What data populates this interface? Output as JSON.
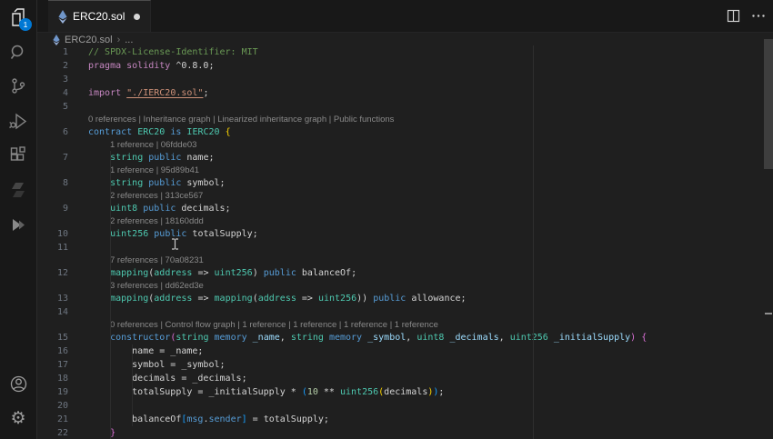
{
  "activity_bar": {
    "explorer_badge": "1",
    "items": [
      "explorer",
      "search",
      "source-control",
      "run-and-debug",
      "extensions",
      "solidity",
      "ethereum",
      "account",
      "settings"
    ]
  },
  "tab_bar": {
    "tabs": [
      {
        "label": "ERC20.sol",
        "modified": true
      }
    ]
  },
  "breadcrumb": {
    "file": "ERC20.sol",
    "chevron": "›",
    "ellipsis": "..."
  },
  "palette": {
    "background": "#1f1f1f",
    "panel": "#181818",
    "comment": "#6a9955",
    "keyword": "#c586c0",
    "type": "#4ec9b0",
    "keyword2": "#569cd6",
    "variable": "#9cdcfe",
    "string": "#ce9178",
    "number": "#b5cea8",
    "text": "#d4d4d4",
    "lens": "#8a8a8a",
    "bracket_gold": "#ffd700",
    "bracket_pink": "#da70d6",
    "bracket_blue": "#179fff",
    "badge": "#0078d4"
  },
  "editor": {
    "rows": [
      {
        "t": "code",
        "n": "1",
        "s": [
          [
            "c",
            "// SPDX-License-Identifier: MIT"
          ]
        ]
      },
      {
        "t": "code",
        "n": "2",
        "s": [
          [
            "k",
            "pragma solidity"
          ],
          [
            "d",
            " ^0.8.0;"
          ]
        ]
      },
      {
        "t": "code",
        "n": "3",
        "s": []
      },
      {
        "t": "code",
        "n": "4",
        "s": [
          [
            "k",
            "import"
          ],
          [
            "d",
            " "
          ],
          [
            "su",
            "\"./IERC20.sol\""
          ],
          [
            "d",
            ";"
          ]
        ]
      },
      {
        "t": "code",
        "n": "5",
        "s": []
      },
      {
        "t": "lens",
        "i": 0,
        "x": "0 references | Inheritance graph | Linearized inheritance graph | Public functions"
      },
      {
        "t": "code",
        "n": "6",
        "s": [
          [
            "b",
            "contract"
          ],
          [
            "d",
            " "
          ],
          [
            "t",
            "ERC20"
          ],
          [
            "d",
            " "
          ],
          [
            "b",
            "is"
          ],
          [
            "d",
            " "
          ],
          [
            "t",
            "IERC20"
          ],
          [
            "d",
            " "
          ],
          [
            "g",
            "{"
          ]
        ]
      },
      {
        "t": "lens",
        "i": 1,
        "x": "1 reference | 06fdde03"
      },
      {
        "t": "code",
        "n": "7",
        "s": [
          [
            "d",
            "    "
          ],
          [
            "t",
            "string"
          ],
          [
            "d",
            " "
          ],
          [
            "b",
            "public"
          ],
          [
            "d",
            " name;"
          ]
        ]
      },
      {
        "t": "lens",
        "i": 1,
        "x": "1 reference | 95d89b41"
      },
      {
        "t": "code",
        "n": "8",
        "s": [
          [
            "d",
            "    "
          ],
          [
            "t",
            "string"
          ],
          [
            "d",
            " "
          ],
          [
            "b",
            "public"
          ],
          [
            "d",
            " symbol;"
          ]
        ]
      },
      {
        "t": "lens",
        "i": 1,
        "x": "2 references | 313ce567"
      },
      {
        "t": "code",
        "n": "9",
        "s": [
          [
            "d",
            "    "
          ],
          [
            "t",
            "uint8"
          ],
          [
            "d",
            " "
          ],
          [
            "b",
            "public"
          ],
          [
            "d",
            " decimals;"
          ]
        ]
      },
      {
        "t": "lens",
        "i": 1,
        "x": "2 references | 18160ddd"
      },
      {
        "t": "code",
        "n": "10",
        "s": [
          [
            "d",
            "    "
          ],
          [
            "t",
            "uint256"
          ],
          [
            "d",
            " "
          ],
          [
            "b",
            "public"
          ],
          [
            "d",
            " totalSupply;"
          ]
        ]
      },
      {
        "t": "code",
        "n": "11",
        "s": []
      },
      {
        "t": "lens",
        "i": 1,
        "x": "7 references | 70a08231"
      },
      {
        "t": "code",
        "n": "12",
        "s": [
          [
            "d",
            "    "
          ],
          [
            "t",
            "mapping"
          ],
          [
            "d",
            "("
          ],
          [
            "t",
            "address"
          ],
          [
            "d",
            " => "
          ],
          [
            "t",
            "uint256"
          ],
          [
            "d",
            ") "
          ],
          [
            "b",
            "public"
          ],
          [
            "d",
            " balanceOf;"
          ]
        ]
      },
      {
        "t": "lens",
        "i": 1,
        "x": "3 references | dd62ed3e"
      },
      {
        "t": "code",
        "n": "13",
        "s": [
          [
            "d",
            "    "
          ],
          [
            "t",
            "mapping"
          ],
          [
            "d",
            "("
          ],
          [
            "t",
            "address"
          ],
          [
            "d",
            " => "
          ],
          [
            "t",
            "mapping"
          ],
          [
            "d",
            "("
          ],
          [
            "t",
            "address"
          ],
          [
            "d",
            " => "
          ],
          [
            "t",
            "uint256"
          ],
          [
            "d",
            ")) "
          ],
          [
            "b",
            "public"
          ],
          [
            "d",
            " allowance;"
          ]
        ]
      },
      {
        "t": "code",
        "n": "14",
        "s": []
      },
      {
        "t": "lens",
        "i": 1,
        "x": "0 references | Control flow graph | 1 reference | 1 reference | 1 reference | 1 reference"
      },
      {
        "t": "code",
        "n": "15",
        "s": [
          [
            "d",
            "    "
          ],
          [
            "b",
            "constructor"
          ],
          [
            "p",
            "("
          ],
          [
            "t",
            "string"
          ],
          [
            "b",
            " memory"
          ],
          [
            "v",
            " _name"
          ],
          [
            "d",
            ", "
          ],
          [
            "t",
            "string"
          ],
          [
            "b",
            " memory"
          ],
          [
            "v",
            " _symbol"
          ],
          [
            "d",
            ", "
          ],
          [
            "t",
            "uint8"
          ],
          [
            "v",
            " _decimals"
          ],
          [
            "d",
            ", "
          ],
          [
            "t",
            "uint256"
          ],
          [
            "v",
            " _initialSupply"
          ],
          [
            "p",
            ")"
          ],
          [
            "d",
            " "
          ],
          [
            "p",
            "{"
          ]
        ]
      },
      {
        "t": "code",
        "n": "16",
        "s": [
          [
            "d",
            "        name = _name;"
          ]
        ]
      },
      {
        "t": "code",
        "n": "17",
        "s": [
          [
            "d",
            "        symbol = _symbol;"
          ]
        ]
      },
      {
        "t": "code",
        "n": "18",
        "s": [
          [
            "d",
            "        decimals = _decimals;"
          ]
        ]
      },
      {
        "t": "code",
        "n": "19",
        "s": [
          [
            "d",
            "        totalSupply = _initialSupply * "
          ],
          [
            "u",
            "("
          ],
          [
            "n2",
            "10"
          ],
          [
            "d",
            " ** "
          ],
          [
            "t",
            "uint256"
          ],
          [
            "g",
            "("
          ],
          [
            "d",
            "decimals"
          ],
          [
            "g",
            ")"
          ],
          [
            "u",
            ")"
          ],
          [
            "d",
            ";"
          ]
        ]
      },
      {
        "t": "code",
        "n": "20",
        "s": []
      },
      {
        "t": "code",
        "n": "21",
        "s": [
          [
            "d",
            "        balanceOf"
          ],
          [
            "u",
            "["
          ],
          [
            "b",
            "msg"
          ],
          [
            "d",
            "."
          ],
          [
            "b",
            "sender"
          ],
          [
            "u",
            "]"
          ],
          [
            "d",
            " = totalSupply;"
          ]
        ]
      },
      {
        "t": "code",
        "n": "22",
        "s": [
          [
            "p",
            "    }"
          ]
        ]
      }
    ]
  }
}
